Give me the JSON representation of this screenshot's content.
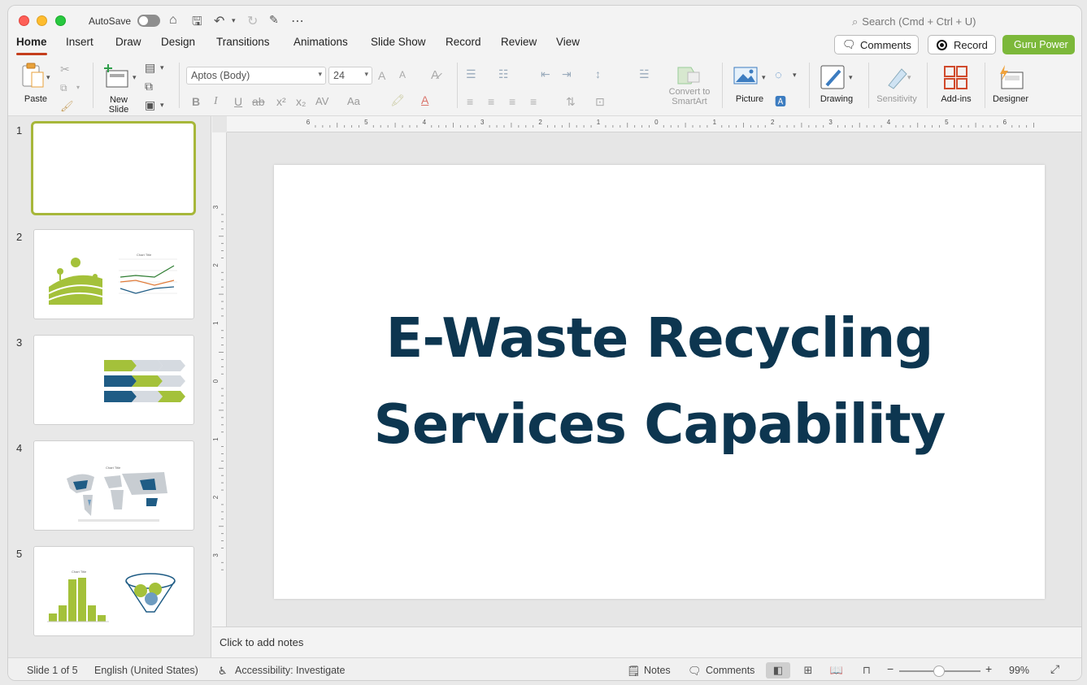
{
  "titlebar": {
    "autosave_label": "AutoSave",
    "search_placeholder": "Search (Cmd + Ctrl + U)"
  },
  "tabs": [
    "Home",
    "Insert",
    "Draw",
    "Design",
    "Transitions",
    "Animations",
    "Slide Show",
    "Record",
    "Review",
    "View"
  ],
  "actions": {
    "comments": "Comments",
    "record": "Record",
    "guru": "Guru Power"
  },
  "ribbon": {
    "paste": "Paste",
    "new_slide_1": "New",
    "new_slide_2": "Slide",
    "font_name": "Aptos (Body)",
    "font_size": "24",
    "convert_1": "Convert to",
    "convert_2": "SmartArt",
    "picture": "Picture",
    "drawing": "Drawing",
    "sensitivity": "Sensitivity",
    "addins": "Add-ins",
    "designer": "Designer",
    "fmt_bold": "B",
    "fmt_italic": "I",
    "fmt_underline": "U",
    "fmt_strike": "ab",
    "fmt_sup": "x²",
    "fmt_sub": "x₂",
    "fmt_spacing": "AV",
    "fmt_case": "Aa",
    "grow_font": "A",
    "shrink_font": "A"
  },
  "slides": [
    {
      "num": "1"
    },
    {
      "num": "2",
      "chart_title": "Chart Title"
    },
    {
      "num": "3"
    },
    {
      "num": "4",
      "chart_title": "Chart Title"
    },
    {
      "num": "5",
      "chart_title": "Chart Title"
    }
  ],
  "ruler": {
    "h_labels": [
      "6",
      "5",
      "4",
      "3",
      "2",
      "1",
      "0",
      "1",
      "2",
      "3",
      "4",
      "5",
      "6"
    ],
    "v_labels": [
      "3",
      "2",
      "1",
      "0",
      "1",
      "2",
      "3"
    ]
  },
  "slide": {
    "title_line1": "E-Waste Recycling",
    "title_line2": "Services Capability"
  },
  "notes": {
    "placeholder": "Click to add notes"
  },
  "status": {
    "slide_count": "Slide 1 of 5",
    "language": "English (United States)",
    "accessibility": "Accessibility: Investigate",
    "notes": "Notes",
    "comments": "Comments",
    "zoom": "99%"
  },
  "colors": {
    "accent_red": "#c43e1c",
    "guru_green": "#7cb83a",
    "title_navy": "#0d3650",
    "thumb_selected": "#a7b73a"
  }
}
